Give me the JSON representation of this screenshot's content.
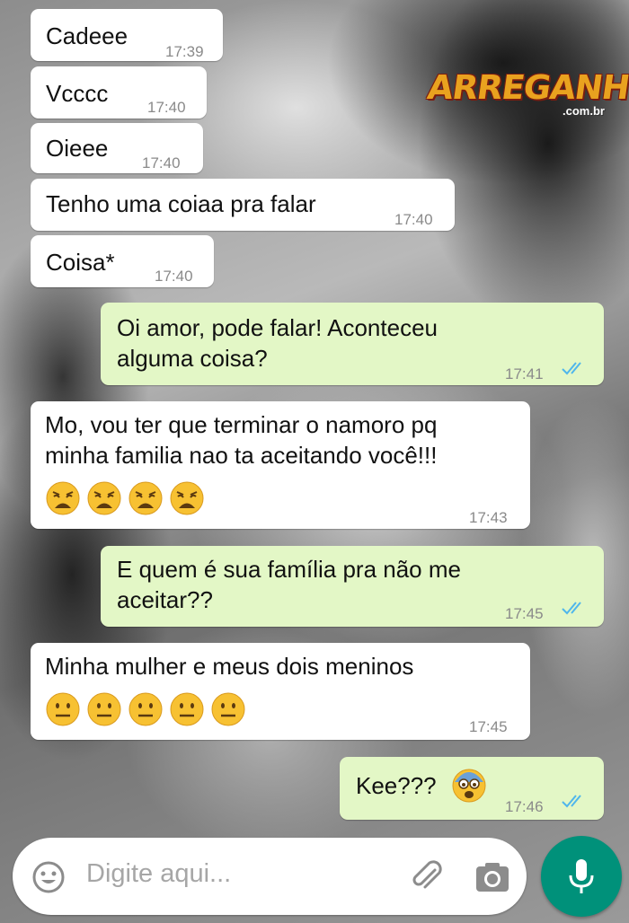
{
  "logo": {
    "main": "ARREGANHO",
    "sub": ".com.br"
  },
  "messages": [
    {
      "dir": "in",
      "text": "Cadeee",
      "time": "17:39"
    },
    {
      "dir": "in",
      "text": "Vcccc",
      "time": "17:40"
    },
    {
      "dir": "in",
      "text": "Oieee",
      "time": "17:40"
    },
    {
      "dir": "in",
      "text": "Tenho uma coiaa pra falar",
      "time": "17:40"
    },
    {
      "dir": "in",
      "text": "Coisa*",
      "time": "17:40"
    },
    {
      "dir": "out",
      "line1": "Oi amor, pode falar! Aconteceu",
      "line2": "alguma coisa?",
      "time": "17:41",
      "status": "read"
    },
    {
      "dir": "in",
      "line1": "Mo, vou ter que terminar o namoro pq",
      "line2": "minha familia nao ta aceitando você!!!",
      "emoji": "weary-face",
      "emoji_count": 4,
      "time": "17:43"
    },
    {
      "dir": "out",
      "line1": "E quem é sua família pra não me",
      "line2": "aceitar??",
      "time": "17:45",
      "status": "read"
    },
    {
      "dir": "in",
      "line1": "Minha mulher e meus dois meninos",
      "emoji": "neutral-face",
      "emoji_count": 5,
      "time": "17:45"
    },
    {
      "dir": "out",
      "text": "Kee???",
      "emoji": "anxious-face",
      "emoji_count": 1,
      "time": "17:46",
      "status": "read"
    }
  ],
  "compose": {
    "placeholder": "Digite aqui...",
    "icons": [
      "smiley-icon",
      "paperclip-icon",
      "camera-icon",
      "microphone-icon"
    ]
  },
  "colors": {
    "incoming_bubble": "#ffffff",
    "outgoing_bubble": "#e3f7c6",
    "read_ticks": "#4fb6ec",
    "mic_button": "#00917a"
  }
}
